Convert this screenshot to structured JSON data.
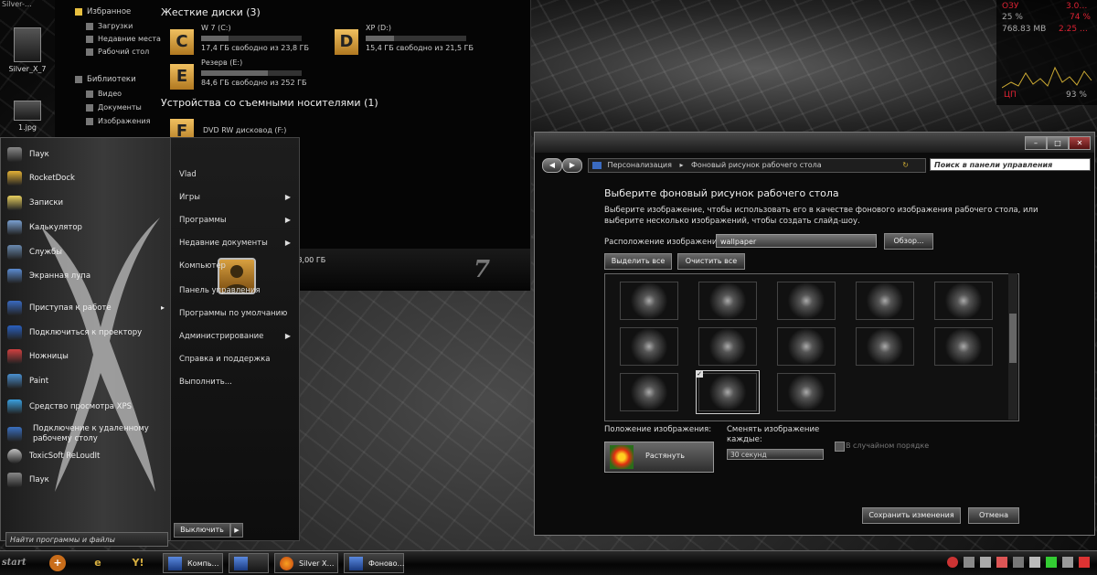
{
  "desktop": {
    "top_label": "Silver-…",
    "icons": [
      {
        "label": "Silver_X_7",
        "icon": "folder-icon"
      },
      {
        "label": "1.jpg",
        "icon": "image-file-icon"
      }
    ]
  },
  "explorer": {
    "nav": {
      "favorites": "Избранное",
      "favorites_items": [
        "Загрузки",
        "Недавние места",
        "Рабочий стол"
      ],
      "libraries": "Библиотеки",
      "libraries_items": [
        "Видео",
        "Документы",
        "Изображения"
      ]
    },
    "hdd_header": "Жесткие диски (3)",
    "drives": [
      {
        "letter": "C",
        "name": "W 7 (C:)",
        "free": "17,4 ГБ свободно из 23,8 ГБ",
        "used_fraction": 0.27
      },
      {
        "letter": "D",
        "name": "XP (D:)",
        "free": "15,4 ГБ свободно из 21,5 ГБ",
        "used_fraction": 0.28
      },
      {
        "letter": "E",
        "name": "Резерв (E:)",
        "free": "84,6 ГБ свободно из 252 ГБ",
        "used_fraction": 0.66
      }
    ],
    "removable_header": "Устройства со съемными носителями (1)",
    "removable_device": "DVD RW дисковод (F:)",
    "status_memory": "…мять: 3,00 ГБ"
  },
  "gauge": {
    "row1": [
      "ОЗУ",
      "3.0…"
    ],
    "row2": [
      "25 %",
      "74 %"
    ],
    "row3": [
      "768.83 MB",
      "2.25 …"
    ],
    "row4": [
      "ЦП",
      "93 %"
    ]
  },
  "start_menu": {
    "programs": [
      {
        "label": "Паук",
        "color": "#888888"
      },
      {
        "label": "RocketDock",
        "color": "#e3b236"
      },
      {
        "label": "Записки",
        "color": "#e8d060"
      },
      {
        "label": "Калькулятор",
        "color": "#7aa0d0"
      },
      {
        "label": "Службы",
        "color": "#6a8ab0"
      },
      {
        "label": "Экранная лупа",
        "color": "#5b8bd0"
      },
      {
        "label": "Приступая к работе",
        "color": "#3a6ac0"
      },
      {
        "label": "Подключиться к проектору",
        "color": "#2a60c0"
      },
      {
        "label": "Ножницы",
        "color": "#d04040"
      },
      {
        "label": "Paint",
        "color": "#4a90d0"
      },
      {
        "label": "Средство просмотра XPS",
        "color": "#3aa0e0"
      },
      {
        "label": "Подключение к удаленному рабочему столу",
        "color": "#3a70c0"
      },
      {
        "label": "ToxicSoft ReLoudIt",
        "color": "#c0c0c0"
      },
      {
        "label": "Паук",
        "color": "#888888"
      }
    ],
    "right_items": [
      {
        "label": "Vlad",
        "arrow": false
      },
      {
        "label": "Игры",
        "arrow": true
      },
      {
        "label": "Программы",
        "arrow": true
      },
      {
        "label": "Недавние документы",
        "arrow": true
      },
      {
        "label": "Компьютер",
        "arrow": false
      },
      {
        "label": "Панель управления",
        "arrow": false
      },
      {
        "label": "Программы по умолчанию",
        "arrow": false
      },
      {
        "label": "Администрирование",
        "arrow": true
      },
      {
        "label": "Справка и поддержка",
        "arrow": false
      },
      {
        "label": "Выполнить...",
        "arrow": false
      }
    ],
    "search_placeholder": "Найти программы и файлы",
    "shutdown_label": "Выключить"
  },
  "personalization": {
    "breadcrumb": [
      "Персонализация",
      "Фоновый рисунок рабочего стола"
    ],
    "search_placeholder": "Поиск в панели управления",
    "heading": "Выберите фоновый рисунок рабочего стола",
    "description_line1": "Выберите изображение, чтобы использовать его в качестве фонового изображения рабочего стола, или",
    "description_line2": "выберите несколько изображений, чтобы создать слайд-шоу.",
    "location_label": "Расположение изображения:",
    "location_value": "wallpaper",
    "browse_label": "Обзор...",
    "select_all_label": "Выделить все",
    "clear_all_label": "Очистить все",
    "thumbnails_count": 13,
    "selected_thumbnail_index": 11,
    "position_label": "Положение изображения:",
    "position_value": "Растянуть",
    "change_every_label_1": "Сменять изображение",
    "change_every_label_2": "каждые:",
    "interval_value": "30 секунд",
    "shuffle_label": "В случайном порядке",
    "save_label": "Сохранить изменения",
    "cancel_label": "Отмена"
  },
  "taskbar": {
    "start_label": "start",
    "tasks": [
      "Компь…",
      "Silver X…",
      "Фоново…"
    ]
  }
}
